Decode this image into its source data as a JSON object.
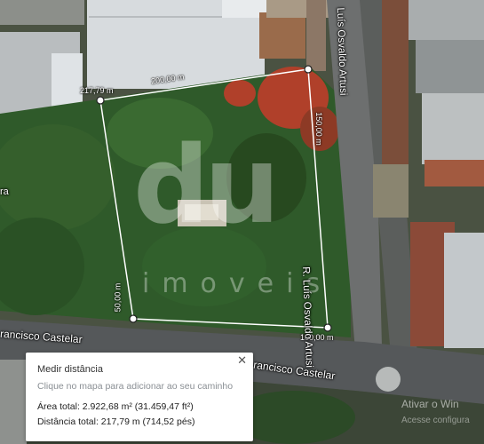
{
  "map": {
    "streets": {
      "east_vertical_top": "Luís Osvaldo Artusi",
      "east_vertical_mid": "R. Luís Osvaldo Artusi",
      "south_left": "rancisco Castelar",
      "south_right": "rancisco Castelar",
      "west_fragment": "ra"
    },
    "segment_labels": {
      "top_left": "217,79 m",
      "top": "200,00 m",
      "right": "150,00 m",
      "left": "50,00 m",
      "bottom": "100,00 m"
    },
    "watermark": {
      "logo": "du",
      "subtitle": "imoveis"
    },
    "colors": {
      "measure_line": "#ffffff",
      "tree_canopy": "#2f5a2a",
      "red_canopy": "#b0402a",
      "roof": "#cfd4d8",
      "road": "#55585a"
    }
  },
  "measure_panel": {
    "title": "Medir distância",
    "subtitle": "Clique no mapa para adicionar ao seu caminho",
    "area_label": "Área total:",
    "area_value": "2.922,68 m² (31.459,47 ft²)",
    "distance_label": "Distância total:",
    "distance_value": "217,79 m (714,52 pés)",
    "close_icon": "close-icon"
  },
  "os_overlay": {
    "line1": "Ativar o Win",
    "line2": "Acesse configura"
  }
}
